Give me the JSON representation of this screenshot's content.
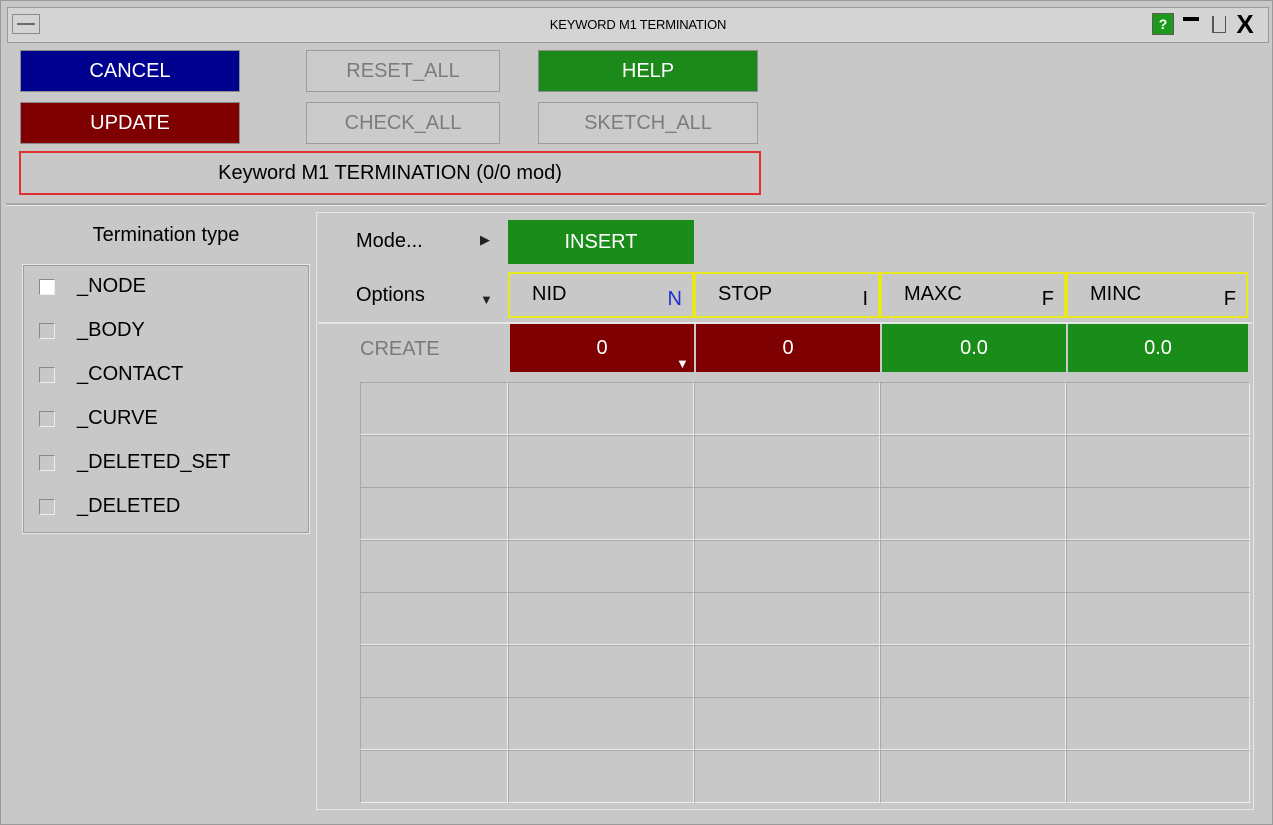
{
  "window": {
    "title": "KEYWORD M1 TERMINATION",
    "help_icon_label": "?",
    "close_label": "X"
  },
  "buttons": {
    "cancel": "CANCEL",
    "update": "UPDATE",
    "reset_all": "RESET_ALL",
    "check_all": "CHECK_ALL",
    "help": "HELP",
    "sketch_all": "SKETCH_ALL"
  },
  "keyword_label": "Keyword M1 TERMINATION (0/0 mod)",
  "termination": {
    "title": "Termination type",
    "items": [
      {
        "label": "_NODE",
        "checked": true
      },
      {
        "label": "_BODY",
        "checked": false
      },
      {
        "label": "_CONTACT",
        "checked": false
      },
      {
        "label": "_CURVE",
        "checked": false
      },
      {
        "label": "_DELETED_SET",
        "checked": false
      },
      {
        "label": "_DELETED",
        "checked": false
      }
    ]
  },
  "mode": {
    "label": "Mode...",
    "value": "INSERT"
  },
  "options_label": "Options",
  "columns": [
    {
      "name": "NID",
      "type": "N",
      "type_color": "#1f2fd0"
    },
    {
      "name": "STOP",
      "type": "I",
      "type_color": "#000000"
    },
    {
      "name": "MAXC",
      "type": "F",
      "type_color": "#000000"
    },
    {
      "name": "MINC",
      "type": "F",
      "type_color": "#000000"
    }
  ],
  "create_row": {
    "label": "CREATE",
    "values": [
      "0",
      "0",
      "0.0",
      "0.0"
    ]
  },
  "colors": {
    "cancel": "#00008e",
    "update": "#7e0000",
    "help": "#1b8a1b",
    "int_field": "#7e0000",
    "float_field": "#1a8c1a",
    "header_border": "#e8e820",
    "keyword_border": "#e03030"
  }
}
